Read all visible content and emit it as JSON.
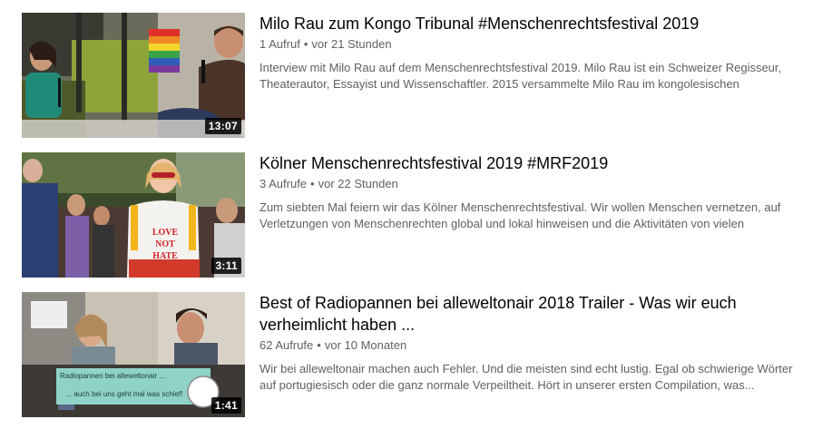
{
  "videos": [
    {
      "title": "Milo Rau zum Kongo Tribunal #Menschenrechtsfestival 2019",
      "views": "1 Aufruf",
      "separator": "•",
      "age": "vor 21 Stunden",
      "description": "Interview mit Milo Rau auf dem Menschenrechtsfestival 2019. Milo Rau ist ein Schweizer Regisseur, Theaterautor, Essayist und Wissenschaftler. 2015 versammelte Milo Rau im kongolesischen",
      "duration": "13:07"
    },
    {
      "title": "Kölner Menschenrechtsfestival 2019 #MRF2019",
      "views": "3 Aufrufe",
      "separator": "•",
      "age": "vor 22 Stunden",
      "description": "Zum siebten Mal feiern wir das Kölner Menschenrechtsfestival. Wir wollen Menschen vernetzen, auf Verletzungen von Menschenrechten global und lokal hinweisen und die Aktivitäten von vielen Individue...",
      "duration": "3:11",
      "shirt_text": [
        "LOVE",
        "NOT",
        "HATE"
      ]
    },
    {
      "title": "Best of Radiopannen bei alleweltonair 2018 Trailer - Was wir euch verheimlicht haben ...",
      "views": "62 Aufrufe",
      "separator": "•",
      "age": "vor 10 Monaten",
      "description": "Wir bei alleweltonair machen auch Fehler. Und die meisten sind echt lustig. Egal ob schwierige Wörter auf portugiesisch oder die ganz normale Verpeiltheit. Hört in unserer ersten Compilation, was...",
      "duration": "1:41",
      "banner_line1": "Radiopannen bei alleweltonair ...",
      "banner_line2": "... auch bei uns geht mal was schief!"
    }
  ]
}
